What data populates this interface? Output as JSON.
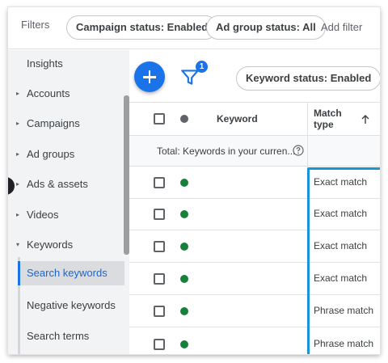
{
  "filterbar": {
    "label": "Filters",
    "chips": {
      "campaign_status": "Campaign status: Enabled",
      "ad_group_status": "Ad group status: All"
    },
    "add_filter": "Add filter"
  },
  "sidebar": {
    "items": [
      {
        "label": "Insights",
        "caret": ""
      },
      {
        "label": "Accounts",
        "caret": "▸"
      },
      {
        "label": "Campaigns",
        "caret": "▸"
      },
      {
        "label": "Ad groups",
        "caret": "▸"
      },
      {
        "label": "Ads & assets",
        "caret": "▸"
      },
      {
        "label": "Videos",
        "caret": "▸"
      },
      {
        "label": "Keywords",
        "caret": "▾"
      },
      {
        "label": "Search keywords",
        "caret": "",
        "selected": true
      },
      {
        "label": "Negative keywords",
        "caret": ""
      },
      {
        "label": "Search terms",
        "caret": ""
      }
    ]
  },
  "toolbar": {
    "filter_badge": "1",
    "keyword_status_chip": "Keyword status: Enabled"
  },
  "table": {
    "headers": {
      "keyword": "Keyword",
      "match_type": "Match type"
    },
    "total_label": "Total: Keywords in your curren...",
    "rows": [
      {
        "match_type": "Exact match"
      },
      {
        "match_type": "Exact match"
      },
      {
        "match_type": "Exact match"
      },
      {
        "match_type": "Exact match"
      },
      {
        "match_type": "Phrase match"
      },
      {
        "match_type": "Phrase match"
      }
    ]
  },
  "colors": {
    "accent": "#1a73e8",
    "enabled_status": "#188038",
    "highlight_box": "#1a95d4"
  }
}
